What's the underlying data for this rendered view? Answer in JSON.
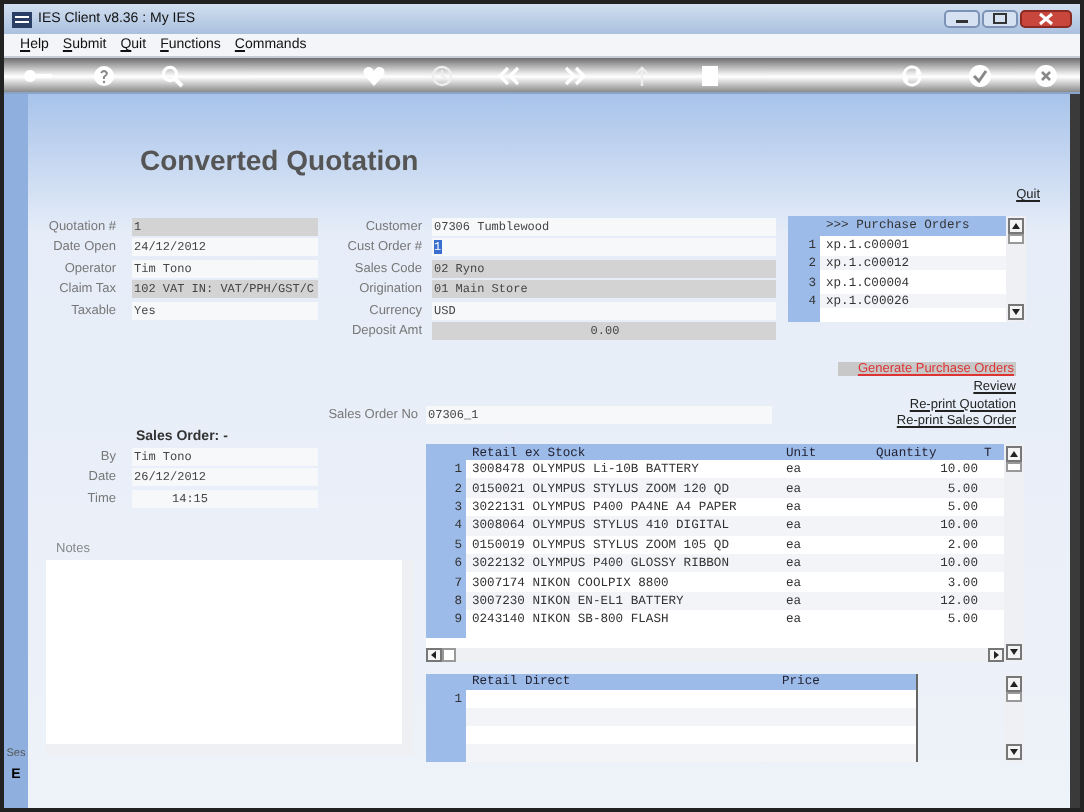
{
  "window": {
    "title": "IES Client v8.36 : My IES"
  },
  "menu": [
    "Help",
    "Submit",
    "Quit",
    "Functions",
    "Commands"
  ],
  "page": {
    "title": "Converted Quotation",
    "quit_link": "Quit"
  },
  "quotation_fields": [
    {
      "label": "Quotation #",
      "value": "1",
      "kind": "readonly",
      "highlighted": false
    },
    {
      "label": "Date Open",
      "value": "24/12/2012",
      "kind": "text",
      "highlighted": false
    },
    {
      "label": "Operator",
      "value": "Tim Tono",
      "kind": "text",
      "highlighted": false
    },
    {
      "label": "Claim Tax",
      "value": "102 VAT IN: VAT/PPH/GST/C",
      "kind": "readonly",
      "highlighted": false
    },
    {
      "label": "Taxable",
      "value": "Yes",
      "kind": "text",
      "highlighted": false
    }
  ],
  "customer_fields": [
    {
      "label": "Customer",
      "value": "07306 Tumblewood",
      "kind": "text",
      "highlighted": false
    },
    {
      "label": "Cust Order #",
      "value": "1",
      "kind": "text",
      "highlighted": true
    },
    {
      "label": "Sales Code",
      "value": "02 Ryno",
      "kind": "readonly",
      "highlighted": false
    },
    {
      "label": "Origination",
      "value": "01 Main Store",
      "kind": "readonly",
      "highlighted": false
    },
    {
      "label": "Currency",
      "value": "USD",
      "kind": "text",
      "highlighted": false
    },
    {
      "label": "Deposit Amt",
      "value": "0.00",
      "kind": "amount",
      "highlighted": false
    }
  ],
  "purchase_orders": {
    "heading": ">>> Purchase Orders",
    "rows": [
      {
        "number": "1",
        "value": "xp.1.c00001"
      },
      {
        "number": "2",
        "value": "xp.1.c00012"
      },
      {
        "number": "3",
        "value": "xp.1.C00004"
      },
      {
        "number": "4",
        "value": "xp.1.C00026"
      }
    ]
  },
  "actions": [
    {
      "label": "Generate Purchase Orders",
      "kind": "highlighted"
    },
    {
      "label": "Review",
      "kind": "link"
    },
    {
      "label": "Re-print Quotation",
      "kind": "link"
    },
    {
      "label": "Re-print Sales Order",
      "kind": "link"
    }
  ],
  "sales_order_no": {
    "label": "Sales Order No",
    "value": "07306_1"
  },
  "sales_order": {
    "heading": "Sales Order: -",
    "fields": [
      {
        "label": "By",
        "value": "Tim Tono",
        "kind": "text"
      },
      {
        "label": "Date",
        "value": "26/12/2012",
        "kind": "text"
      },
      {
        "label": "Time",
        "value": "14:15",
        "kind": "time"
      }
    ]
  },
  "notes": {
    "label": "Notes"
  },
  "stock_table": {
    "columns": [
      "Retail ex Stock",
      "Unit",
      "Quantity",
      "T"
    ],
    "rows": [
      {
        "number": "1",
        "item": "3008478 OLYMPUS Li-10B BATTERY",
        "unit": "ea",
        "quantity": "10.00"
      },
      {
        "number": "2",
        "item": "0150021 OLYMPUS STYLUS ZOOM 120 QD",
        "unit": "ea",
        "quantity": "5.00"
      },
      {
        "number": "3",
        "item": "3022131 OLYMPUS P400 PA4NE A4 PAPER",
        "unit": "ea",
        "quantity": "5.00"
      },
      {
        "number": "4",
        "item": "3008064 OLYMPUS STYLUS 410 DIGITAL",
        "unit": "ea",
        "quantity": "10.00"
      },
      {
        "number": "5",
        "item": "0150019 OLYMPUS STYLUS ZOOM 105 QD",
        "unit": "ea",
        "quantity": "2.00"
      },
      {
        "number": "6",
        "item": "3022132 OLYMPUS P400 GLOSSY RIBBON",
        "unit": "ea",
        "quantity": "10.00"
      },
      {
        "number": "7",
        "item": "3007174 NIKON COOLPIX 8800",
        "unit": "ea",
        "quantity": "3.00"
      },
      {
        "number": "8",
        "item": "3007230 NIKON EN-EL1 BATTERY",
        "unit": "ea",
        "quantity": "12.00"
      },
      {
        "number": "9",
        "item": "0243140 NIKON SB-800 FLASH",
        "unit": "ea",
        "quantity": "5.00"
      }
    ]
  },
  "retail_table": {
    "columns": [
      "Retail Direct",
      "Price"
    ],
    "rows": [
      {
        "number": "1"
      }
    ]
  },
  "side_tab": [
    "Ses",
    "E"
  ]
}
